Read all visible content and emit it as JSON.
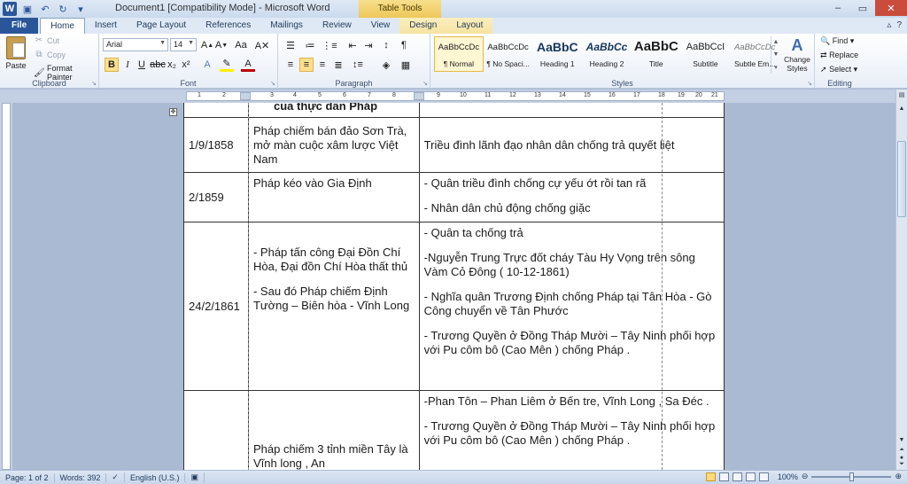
{
  "window": {
    "title": "Document1 [Compatibility Mode]  -  Microsoft Word",
    "context_tab_header": "Table Tools"
  },
  "tabs": [
    "File",
    "Home",
    "Insert",
    "Page Layout",
    "References",
    "Mailings",
    "Review",
    "View",
    "Design",
    "Layout"
  ],
  "clipboard": {
    "paste": "Paste",
    "cut": "Cut",
    "copy": "Copy",
    "format_painter": "Format Painter",
    "label": "Clipboard"
  },
  "font": {
    "name": "Arial",
    "size": "14",
    "label": "Font"
  },
  "paragraph": {
    "label": "Paragraph"
  },
  "styles": {
    "label": "Styles",
    "items": [
      {
        "sample": "AaBbCcDc",
        "name": "¶ Normal"
      },
      {
        "sample": "AaBbCcDc",
        "name": "¶ No Spaci..."
      },
      {
        "sample": "AaBbC",
        "name": "Heading 1"
      },
      {
        "sample": "AaBbCc",
        "name": "Heading 2"
      },
      {
        "sample": "AaBbC",
        "name": "Title"
      },
      {
        "sample": "AaBbCcI",
        "name": "Subtitle"
      },
      {
        "sample": "AaBbCcDc",
        "name": "Subtle Em..."
      }
    ],
    "change_styles": "Change Styles"
  },
  "editing": {
    "find": "Find",
    "replace": "Replace",
    "select": "Select",
    "label": "Editing"
  },
  "ruler_numbers": [
    "1",
    "2",
    "3",
    "4",
    "5",
    "6",
    "7",
    "8",
    "9",
    "10",
    "11",
    "12",
    "13",
    "14",
    "15",
    "16",
    "17",
    "18",
    "19",
    "20",
    "21"
  ],
  "table": {
    "top_partial": {
      "c2": "của thực dân Pháp"
    },
    "rows": [
      {
        "date": "1/9/1858",
        "event": [
          "Pháp chiếm bán đảo Sơn Trà, mở màn cuộc xâm lược Việt Nam"
        ],
        "response": [
          "Triều đình lãnh đạo nhân dân chống trả quyết liệt"
        ]
      },
      {
        "date": "2/1859",
        "event": [
          "Pháp kéo vào Gia Định"
        ],
        "response": [
          "- Quân triều đình chống cự yếu ớt rồi tan rã",
          "- Nhân dân chủ động chống giặc"
        ]
      },
      {
        "date": "24/2/1861",
        "event": [
          "- Pháp tấn công Đại Đồn Chí Hòa, Đại đồn Chí Hòa thất thủ",
          "- Sau đó Pháp chiếm Định Tường – Biên hòa - Vĩnh Long"
        ],
        "response": [
          "- Quân ta chống trả",
          "-Nguyễn Trung Trực  đốt cháy Tàu Hy Vọng trên sông Vàm Cỏ Đông ( 10-12-1861)",
          "- Nghĩa quân Trương Định chống Pháp tại Tân Hòa - Gò Công chuyển về Tân Phước",
          "- Trương Quyền ở Đồng Tháp Mười – Tây Ninh phối hợp  với Pu côm bô (Cao Mên ) chống Pháp ."
        ]
      },
      {
        "date": "",
        "event": [
          "Pháp chiếm 3 tỉnh miền Tây là Vĩnh long , An"
        ],
        "response": [
          "-Phan Tôn – Phan Liêm  ở Bến tre, Vĩnh Long , Sa Đéc .",
          "- Trương Quyền ở Đồng Tháp Mười – Tây Ninh phối hợp  với Pu côm bô (Cao Mên ) chống Pháp ."
        ]
      }
    ]
  },
  "status": {
    "page": "Page: 1 of 2",
    "words": "Words: 392",
    "language": "English (U.S.)",
    "zoom": "100%"
  }
}
